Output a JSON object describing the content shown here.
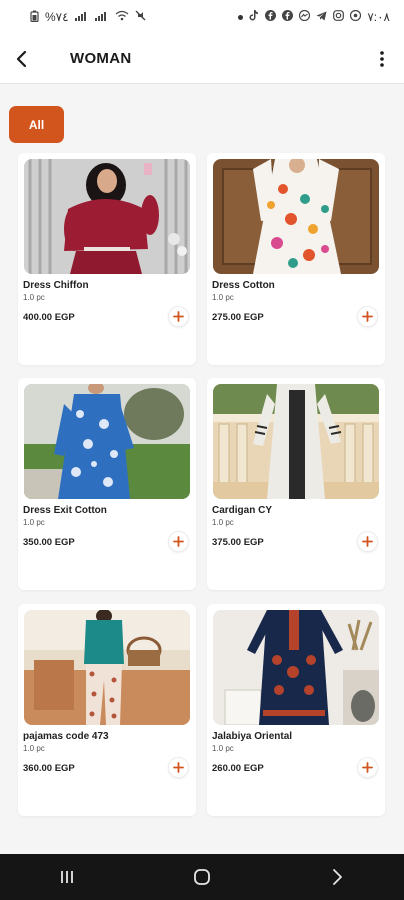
{
  "status_bar": {
    "left_text": "%٧٤",
    "right_text": "٧:٠٨"
  },
  "header": {
    "title": "WOMAN"
  },
  "filters": {
    "selected": "All"
  },
  "products": [
    {
      "name": "Dress Chiffon",
      "unit": "1.0 pc",
      "price": "400.00 EGP"
    },
    {
      "name": "Dress Cotton",
      "unit": "1.0 pc",
      "price": "275.00 EGP"
    },
    {
      "name": "Dress Exit Cotton",
      "unit": "1.0 pc",
      "price": "350.00 EGP"
    },
    {
      "name": "Cardigan CY",
      "unit": "1.0 pc",
      "price": "375.00 EGP"
    },
    {
      "name": "pajamas code 473",
      "unit": "1.0 pc",
      "price": "360.00 EGP"
    },
    {
      "name": "Jalabiya Oriental",
      "unit": "1.0 pc",
      "price": "260.00 EGP"
    }
  ],
  "colors": {
    "accent": "#d2551d",
    "card": "#ffffff",
    "background": "#f5f5f5",
    "nav_bar": "#151515"
  },
  "icons": {
    "back": "arrow-left-icon",
    "menu": "more-vertical-icon",
    "add": "plus-icon",
    "nav_recents": "recents-icon",
    "nav_home": "home-icon",
    "nav_back": "chevron-right-icon"
  }
}
